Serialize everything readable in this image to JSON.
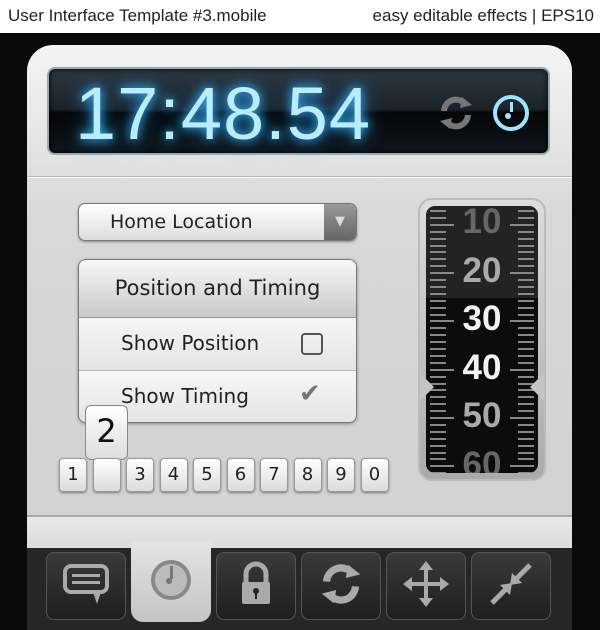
{
  "header": {
    "left": "User Interface Template #3.mobile",
    "right": "easy editable effects | EPS10"
  },
  "display": {
    "time": "17:48.54",
    "icons": [
      "refresh-icon",
      "stopwatch-icon"
    ],
    "glow_color": "#b9ecff"
  },
  "dropdown": {
    "selected": "Home Location"
  },
  "settings": {
    "title": "Position and Timing",
    "items": [
      {
        "label": "Show Position",
        "checked": false
      },
      {
        "label": "Show Timing",
        "checked": true
      }
    ]
  },
  "ruler": {
    "labels": [
      "10",
      "20",
      "30",
      "40",
      "50",
      "60"
    ],
    "selected": "40"
  },
  "keypad": {
    "keys": [
      "1",
      "2",
      "3",
      "4",
      "5",
      "6",
      "7",
      "8",
      "9",
      "0"
    ],
    "pressed": "2"
  },
  "tabs": [
    {
      "icon": "chat-icon",
      "active": false
    },
    {
      "icon": "stopwatch-icon",
      "active": true
    },
    {
      "icon": "lock-icon",
      "active": false
    },
    {
      "icon": "sync-icon",
      "active": false
    },
    {
      "icon": "move-icon",
      "active": false
    },
    {
      "icon": "collapse-icon",
      "active": false
    }
  ]
}
